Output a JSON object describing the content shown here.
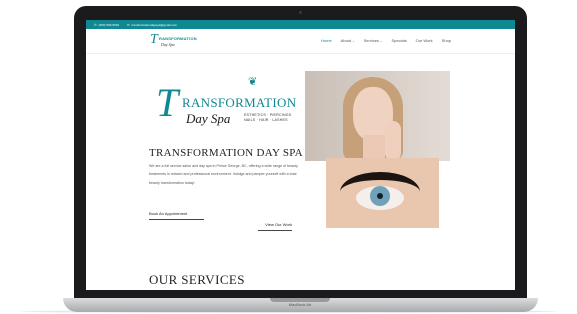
{
  "device": {
    "brand_label": "MacBook Air"
  },
  "topbar": {
    "phone": "(250) 596-5934",
    "email": "transformationdayspa@gmail.com",
    "background_color": "#0f8892"
  },
  "nav": {
    "logo": {
      "word1": "RANSFORMATION",
      "word2": "Day Spa"
    },
    "items": [
      {
        "label": "Home",
        "active": true
      },
      {
        "label": "About",
        "has_dropdown": true
      },
      {
        "label": "Services",
        "has_dropdown": true
      },
      {
        "label": "Specials"
      },
      {
        "label": "Our Work"
      },
      {
        "label": "Shop"
      }
    ]
  },
  "hero": {
    "logo": {
      "initial": "T",
      "word1": "RANSFORMATION",
      "word2": "Day Spa",
      "tagline_line1": "ESTHETICS · PIERCINGS",
      "tagline_line2": "NAILS · HAIR · LASHES"
    },
    "title": "TRANSFORMATION DAY SPA",
    "description": "We are a full service salon and day spa in Prince George, BC, offering a wide range of beauty treatments in relaxed and professional environment. Indulge and pamper yourself with a total beauty transformation today!",
    "primary_button": "Book An Appointment",
    "secondary_button": "View Our Work"
  },
  "section": {
    "title": "OUR SERVICES"
  },
  "colors": {
    "brand": "#0f8892",
    "text": "#222222"
  },
  "icons": {
    "phone": "phone-icon",
    "email": "envelope-icon",
    "dropdown": "chevron-down-icon",
    "leaf": "lotus-leaf-icon"
  }
}
